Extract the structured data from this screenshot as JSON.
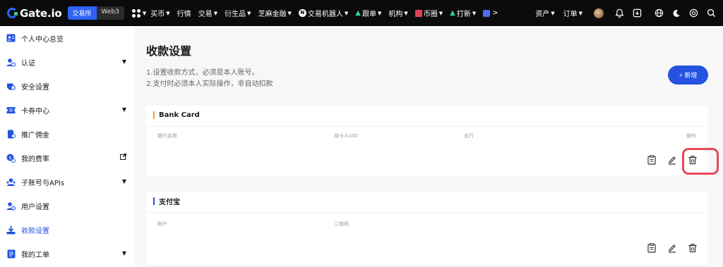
{
  "topbar": {
    "logo": "Gate.io",
    "mode_exchange": "交易所",
    "mode_web3": "Web3",
    "nav": [
      {
        "label": "买币",
        "caret": true
      },
      {
        "label": "行情",
        "caret": false
      },
      {
        "label": "交易",
        "caret": true
      },
      {
        "label": "衍生品",
        "caret": true
      },
      {
        "label": "芝麻金融",
        "caret": true
      },
      {
        "label": "交易机器人",
        "caret": true,
        "icon": "N"
      },
      {
        "label": "跟单",
        "caret": true,
        "icon": "flame"
      },
      {
        "label": "机构",
        "caret": true
      },
      {
        "label": "币圈",
        "caret": true,
        "icon": "chart"
      },
      {
        "label": "打新",
        "caret": true,
        "icon": "flame"
      }
    ],
    "more": ">",
    "assets": "资产",
    "orders": "订单"
  },
  "sidebar": {
    "items": [
      {
        "label": "个人中心总览",
        "icon": "profile-card-icon",
        "chevron": false
      },
      {
        "label": "认证",
        "icon": "verify-user-icon",
        "chevron": true
      },
      {
        "label": "安全设置",
        "icon": "shield-icon",
        "chevron": false
      },
      {
        "label": "卡券中心",
        "icon": "ticket-icon",
        "chevron": true
      },
      {
        "label": "推广佣金",
        "icon": "referral-icon",
        "chevron": false
      },
      {
        "label": "我的费率",
        "icon": "fee-icon",
        "chevron": false,
        "external": true
      },
      {
        "label": "子账号与APIs",
        "icon": "sub-account-icon",
        "chevron": true
      },
      {
        "label": "用户设置",
        "icon": "user-settings-icon",
        "chevron": false
      },
      {
        "label": "收款设置",
        "icon": "payment-download-icon",
        "chevron": false,
        "active": true
      },
      {
        "label": "我的工单",
        "icon": "ticket-list-icon",
        "chevron": true
      }
    ]
  },
  "main": {
    "title": "收款设置",
    "notes": [
      "1.设置收款方式，必须是本人账号。",
      "2.支付时必须本人实际操作，非自动扣款"
    ],
    "add_button": "+ 新增",
    "bank": {
      "title": "Bank Card",
      "columns": [
        "银行名称",
        "持卡人UID",
        "支行",
        "操作"
      ]
    },
    "alipay": {
      "title": "支付宝",
      "columns": [
        "账户",
        "二维码"
      ]
    }
  },
  "colors": {
    "accent": "#2353e0",
    "bank_bar": "#f0a02a",
    "alipay_bar": "#2353e0",
    "highlight": "#e6475b"
  }
}
